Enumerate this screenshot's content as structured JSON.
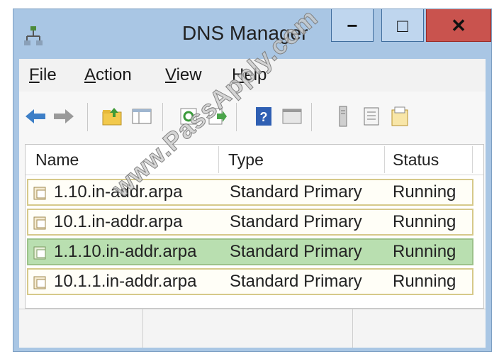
{
  "window": {
    "title": "DNS Manager",
    "controls": {
      "minimize": "−",
      "maximize": "□",
      "close": "✕"
    },
    "colors": {
      "frame": "#a9c6e4",
      "close": "#c9534e",
      "selected_row": "#b9dfb0",
      "row_border": "#d6c98a"
    }
  },
  "menu": {
    "items": [
      {
        "label": "File",
        "underline": "F"
      },
      {
        "label": "Action",
        "underline": "A"
      },
      {
        "label": "View",
        "underline": "V"
      },
      {
        "label": "Help",
        "underline": "H"
      }
    ]
  },
  "toolbar": {
    "icons": [
      "back-arrow-icon",
      "forward-arrow-icon",
      "folder-up-icon",
      "show-hide-tree-icon",
      "refresh-icon",
      "export-list-icon",
      "help-icon",
      "properties-icon",
      "server-icon",
      "records-icon",
      "zone-icon"
    ]
  },
  "list": {
    "columns": [
      "Name",
      "Type",
      "Status"
    ],
    "rows": [
      {
        "name": "1.10.in-addr.arpa",
        "type": "Standard Primary",
        "status": "Running",
        "selected": false
      },
      {
        "name": "10.1.in-addr.arpa",
        "type": "Standard Primary",
        "status": "Running",
        "selected": false
      },
      {
        "name": "1.1.10.in-addr.arpa",
        "type": "Standard Primary",
        "status": "Running",
        "selected": true
      },
      {
        "name": "10.1.1.in-addr.arpa",
        "type": "Standard Primary",
        "status": "Running",
        "selected": false
      }
    ]
  },
  "watermark": "www.PassApply.com"
}
